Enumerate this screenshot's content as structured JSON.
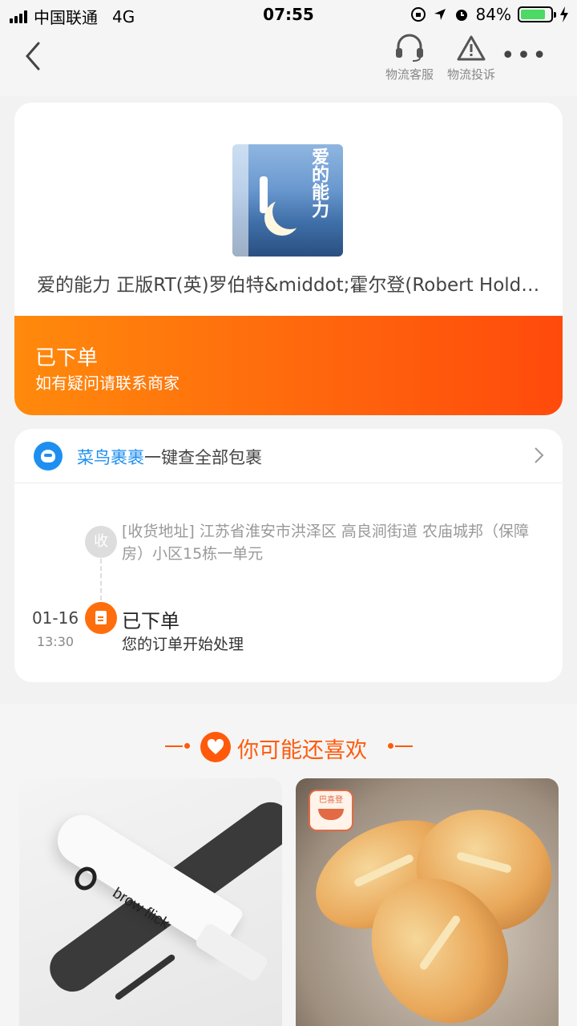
{
  "status_bar": {
    "carrier": "中国联通",
    "network": "4G",
    "time": "07:55",
    "battery_percent": "84%",
    "battery_level": 0.84
  },
  "nav": {
    "customer_service_label": "物流客服",
    "complaint_label": "物流投诉",
    "more_label": "•••"
  },
  "product": {
    "cover_title": "爱的能力",
    "name": "爱的能力 正版RT(英)罗伯特&middot;霍尔登(Robert Holden)"
  },
  "order_status": {
    "title": "已下单",
    "subtitle": "如有疑问请联系商家"
  },
  "logistics": {
    "brand": "菜鸟裹裹",
    "brand_suffix": "一键查全部包裹",
    "address_badge": "收",
    "address": "[收货地址] 江苏省淮安市洪泽区 高良涧街道  农庙城邦（保障房）小区15栋一单元",
    "event": {
      "date": "01-16",
      "time": "13:30",
      "title": "已下单",
      "description": "您的订单开始处理"
    }
  },
  "recommend": {
    "title": "你可能还喜欢",
    "items": [
      {
        "brand_text": "brow flick"
      },
      {
        "badge_text": "巴喜登"
      }
    ]
  },
  "colors": {
    "accent_orange": "#ff5a0c",
    "cainiao_blue": "#1e8ff0"
  }
}
